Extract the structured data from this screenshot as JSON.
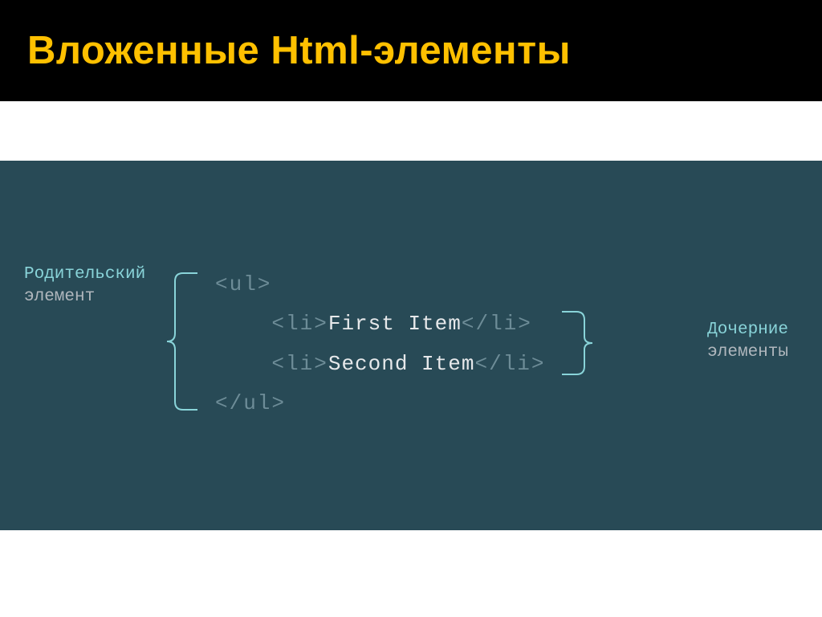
{
  "header": {
    "title": "Вложенные Html-элементы"
  },
  "labels": {
    "parent_line1": "Родительский",
    "parent_line2": "элемент",
    "child_line1": "Дочерние",
    "child_line2": "элементы"
  },
  "code": {
    "ul_open": "<ul>",
    "li_open": "<li>",
    "li_close": "</li>",
    "ul_close": "</ul>",
    "item1": "First Item",
    "item2": "Second Item"
  },
  "colors": {
    "accent": "#ffc000",
    "panel_bg": "#284a56",
    "label_primary": "#89d4d9",
    "label_secondary": "#b0b7bd",
    "tag_color": "#6d8c97",
    "text_color": "#e6e8ea"
  }
}
